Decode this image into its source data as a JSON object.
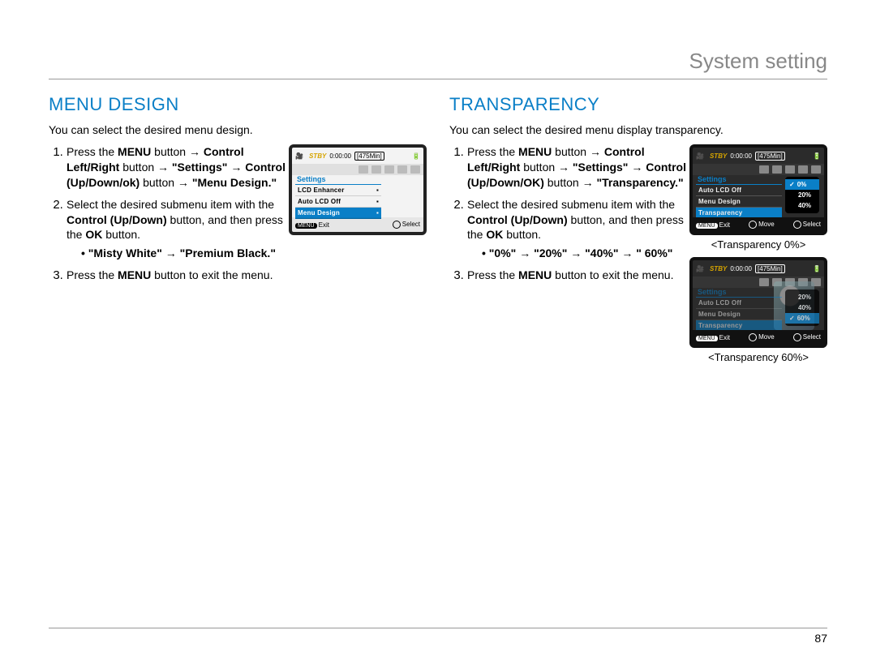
{
  "header": {
    "title": "System setting"
  },
  "page_number": "87",
  "left": {
    "title": "MENU DESIGN",
    "intro": "You can select the desired menu design.",
    "step1_a": "Press the ",
    "step1_b": "MENU",
    "step1_c": " button → ",
    "step1_d": "Control Left/Right",
    "step1_e": " button → ",
    "step1_f": "\"Settings\"",
    "step1_g": " → ",
    "step1_h": "Control (Up/Down/ok)",
    "step1_i": " button → ",
    "step1_j": "\"Menu Design.\"",
    "step2_a": "Select the desired submenu item with the ",
    "step2_b": "Control (Up/Down)",
    "step2_c": " button, and then press the ",
    "step2_d": "OK",
    "step2_e": " button.",
    "bullet1": "\"Misty White\" → \"Premium Black.\"",
    "step3_a": "Press the ",
    "step3_b": "MENU",
    "step3_c": " button to exit the menu.",
    "lcd": {
      "stby": "STBY",
      "timecode": "0:00:00",
      "remain": "[475Min]",
      "menu_header": "Settings",
      "rows": [
        "LCD Enhancer",
        "Auto LCD Off",
        "Menu Design"
      ],
      "bottom_exit": "Exit",
      "bottom_select": "Select",
      "menu_pill": "MENU"
    }
  },
  "right": {
    "title": "TRANSPARENCY",
    "intro": "You can select the desired menu display transparency.",
    "step1_a": "Press the ",
    "step1_b": "MENU",
    "step1_c": " button → ",
    "step1_d": "Control Left/Right",
    "step1_e": " button → ",
    "step1_f": "\"Settings\"",
    "step1_g": " → ",
    "step1_h": "Control (Up/Down/OK)",
    "step1_i": " button → ",
    "step1_j": "\"Transparency.\"",
    "step2_a": "Select the desired submenu item with the ",
    "step2_b": "Control (Up/Down)",
    "step2_c": " button, and then press the ",
    "step2_d": "OK",
    "step2_e": " button.",
    "bullet1": "\"0%\" → \"20%\" → \"40%\" → \" 60%\"",
    "step3_a": "Press the ",
    "step3_b": "MENU",
    "step3_c": " button to exit the menu.",
    "lcd1": {
      "stby": "STBY",
      "timecode": "0:00:00",
      "remain": "[475Min]",
      "menu_header": "Settings",
      "rows": [
        "Auto LCD Off",
        "Menu Design",
        "Transparency"
      ],
      "popup": [
        "0%",
        "20%",
        "40%"
      ],
      "bottom_exit": "Exit",
      "bottom_move": "Move",
      "bottom_select": "Select",
      "menu_pill": "MENU",
      "caption": "<Transparency 0%>"
    },
    "lcd2": {
      "stby": "STBY",
      "timecode": "0:00:00",
      "remain": "[475Min]",
      "menu_header": "Settings",
      "rows": [
        "Auto LCD Off",
        "Menu Design",
        "Transparency"
      ],
      "popup": [
        "20%",
        "40%",
        "60%"
      ],
      "bottom_exit": "Exit",
      "bottom_move": "Move",
      "bottom_select": "Select",
      "menu_pill": "MENU",
      "caption": "<Transparency 60%>"
    }
  }
}
